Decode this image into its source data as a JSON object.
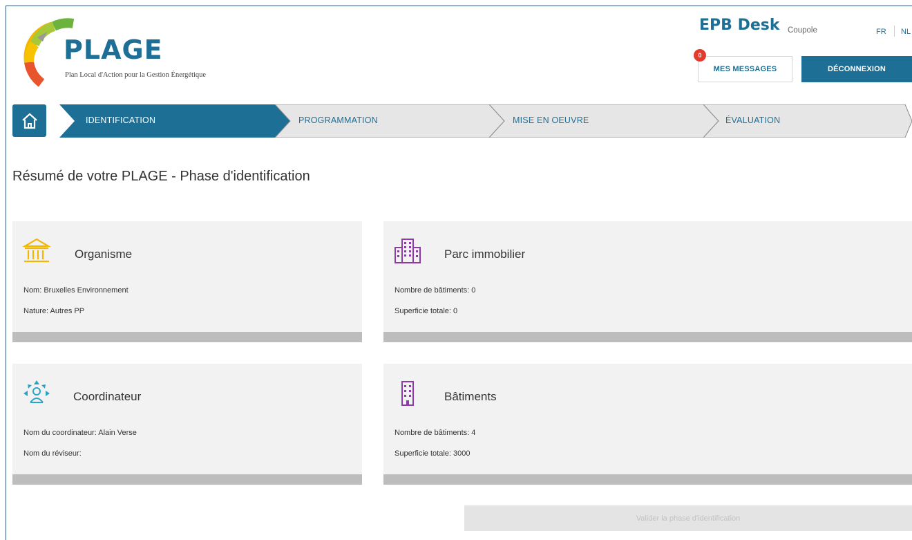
{
  "brand": {
    "logo_title": "PLAGE",
    "logo_subtitle": "Plan Local d'Action pour la Gestion Énergétique",
    "app_name": "EPB Desk",
    "app_sub": "Coupole"
  },
  "header": {
    "languages": [
      "FR",
      "NL"
    ],
    "messages_label": "MES MESSAGES",
    "messages_count": "0",
    "logout_label": "DÉCONNEXION"
  },
  "steps": [
    {
      "label": "IDENTIFICATION",
      "active": true
    },
    {
      "label": "PROGRAMMATION",
      "active": false
    },
    {
      "label": "MISE EN OEUVRE",
      "active": false
    },
    {
      "label": "ÉVALUATION",
      "active": false
    }
  ],
  "page_title": "Résumé de votre PLAGE - Phase d'identification",
  "cards": {
    "organisme": {
      "title": "Organisme",
      "line1": "Nom: Bruxelles Environnement",
      "line2": "Nature: Autres PP",
      "icon": "institution-icon",
      "icon_color": "#f2b705"
    },
    "parc": {
      "title": "Parc immobilier",
      "line1": "Nombre de bâtiments: 0",
      "line2": "Superficie totale: 0",
      "icon": "buildings-icon",
      "icon_color": "#8e3aa8"
    },
    "coordinateur": {
      "title": "Coordinateur",
      "line1": "Nom du coordinateur: Alain Verse",
      "line2": "Nom du réviseur:",
      "icon": "coordinator-icon",
      "icon_color": "#2aa4c6"
    },
    "batiments": {
      "title": "Bâtiments",
      "line1": "Nombre de bâtiments: 4",
      "line2": "Superficie totale: 3000",
      "icon": "building-icon",
      "icon_color": "#8e3aa8"
    }
  },
  "validate_label": "Valider la phase d'identification",
  "colors": {
    "primary": "#1d6f96",
    "badge": "#e53b2c",
    "card_bg": "#f2f2f2",
    "card_footer": "#bdbdbd",
    "step_inactive": "#e6e6e6"
  }
}
